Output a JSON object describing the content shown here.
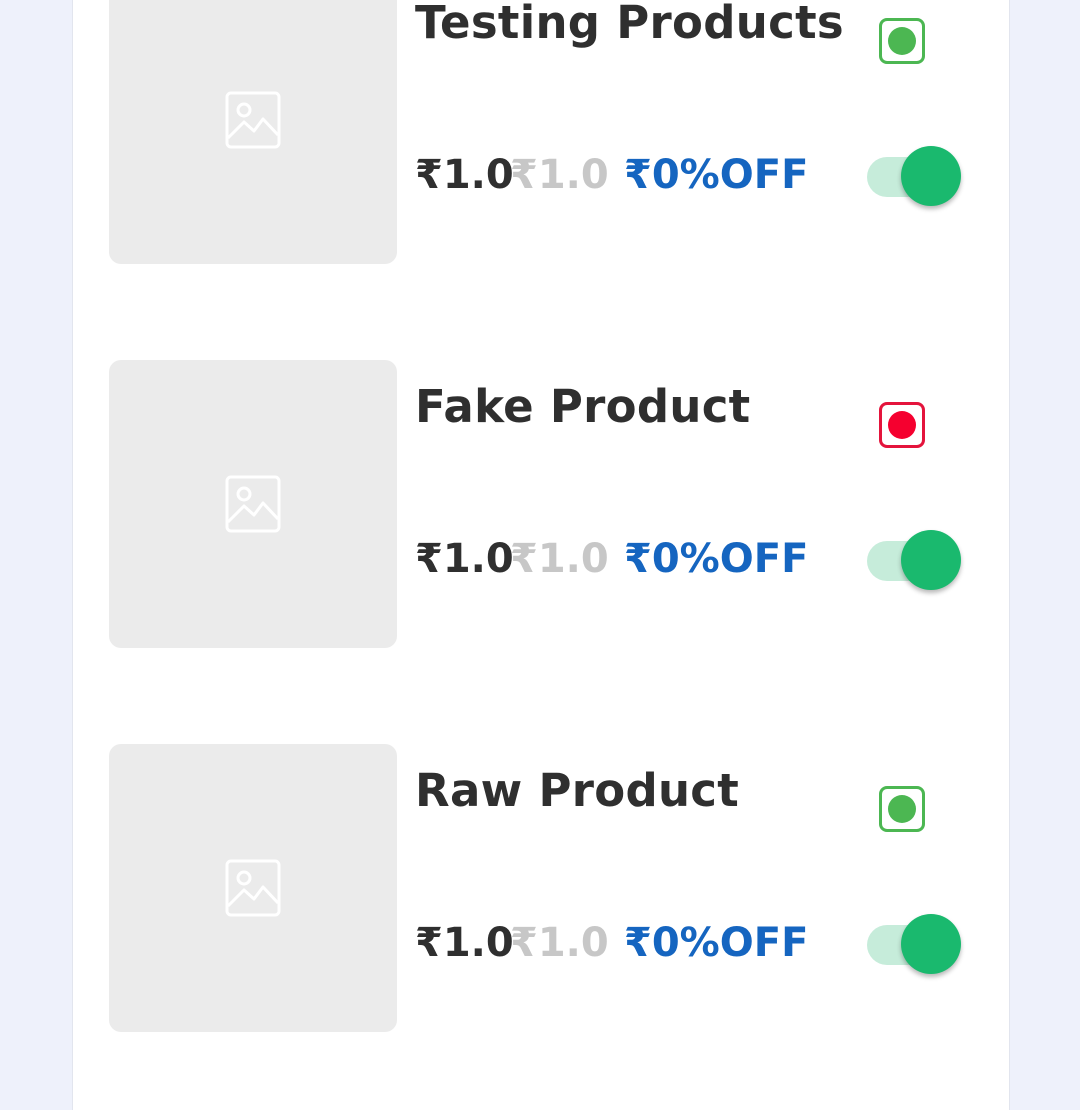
{
  "colors": {
    "page_bg": "#eef1fb",
    "card_bg": "#ffffff",
    "veg_green": "#4cb752",
    "nonveg_red": "#e4143c",
    "toggle_on": "#1ab96e",
    "toggle_track": "#c6ecda",
    "discount_blue": "#1565c0"
  },
  "products": [
    {
      "name": "Testing Products",
      "type": "veg",
      "price": "₹1.0",
      "mrp": "₹1.0",
      "discount": "₹0%OFF",
      "enabled": true,
      "image_icon": "image-placeholder-icon"
    },
    {
      "name": "Fake Product",
      "type": "non-veg",
      "price": "₹1.0",
      "mrp": "₹1.0",
      "discount": "₹0%OFF",
      "enabled": true,
      "image_icon": "image-placeholder-icon"
    },
    {
      "name": "Raw Product",
      "type": "veg",
      "price": "₹1.0",
      "mrp": "₹1.0",
      "discount": "₹0%OFF",
      "enabled": true,
      "image_icon": "image-placeholder-icon"
    }
  ]
}
